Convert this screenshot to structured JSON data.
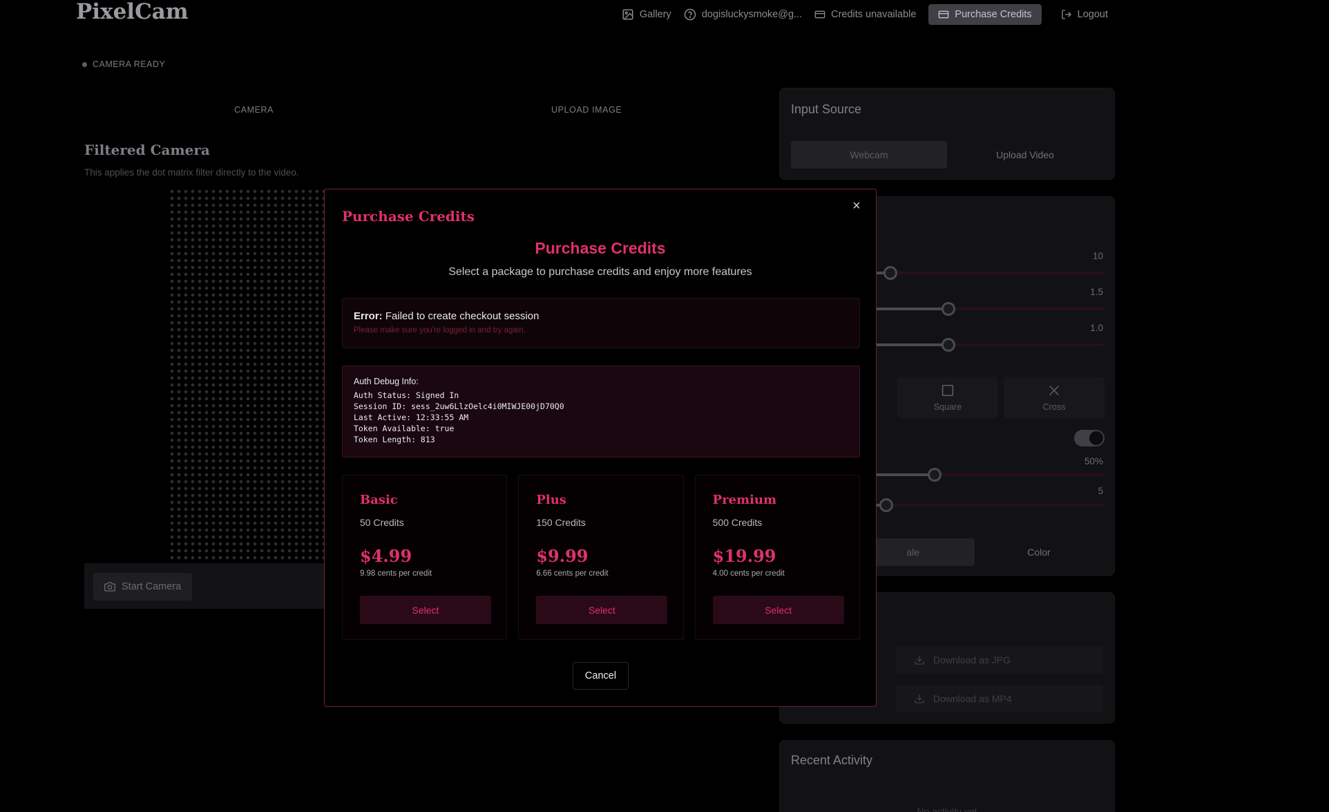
{
  "header": {
    "logo": "PixelCam",
    "nav": {
      "gallery": "Gallery",
      "email": "dogisluckysmoke@g...",
      "credits": "Credits unavailable",
      "purchase": "Purchase Credits",
      "logout": "Logout"
    }
  },
  "camera": {
    "status": "CAMERA READY",
    "tab_camera": "CAMERA",
    "tab_upload": "UPLOAD IMAGE",
    "title": "Filtered Camera",
    "subtitle": "This applies the dot matrix filter directly to the video.",
    "start_button": "Start Camera"
  },
  "input_source": {
    "title": "Input Source",
    "tab_webcam": "Webcam",
    "tab_upload_video": "Upload Video"
  },
  "settings": {
    "slider_values": [
      "10",
      "1.5",
      "1.0",
      "50%",
      "5"
    ],
    "shape_square": "Square",
    "shape_cross": "Cross",
    "mode_grayscale_partial": "ale",
    "mode_color": "Color"
  },
  "export": {
    "jpg": "Download as JPG",
    "mp4": "Download as MP4"
  },
  "activity": {
    "title": "Recent Activity",
    "empty": "No activity yet"
  },
  "modal": {
    "header": "Purchase Credits",
    "title": "Purchase Credits",
    "subtitle": "Select a package to purchase credits and enjoy more features",
    "error": {
      "label": "Error:",
      "message": " Failed to create checkout session",
      "hint": "Please make sure you're logged in and try again."
    },
    "debug": {
      "title": "Auth Debug Info:",
      "lines": [
        "Auth Status: Signed In",
        "Session ID: sess_2uw6LlzOelc4i0MIWJE00jD70Q0",
        "Last Active: 12:33:55 AM",
        "Token Available: true",
        "Token Length: 813"
      ]
    },
    "plans": [
      {
        "name": "Basic",
        "credits": "50 Credits",
        "price": "$4.99",
        "per_credit": "9.98 cents per credit",
        "button": "Select"
      },
      {
        "name": "Plus",
        "credits": "150 Credits",
        "price": "$9.99",
        "per_credit": "6.66 cents per credit",
        "button": "Select"
      },
      {
        "name": "Premium",
        "credits": "500 Credits",
        "price": "$19.99",
        "per_credit": "4.00 cents per credit",
        "button": "Select"
      }
    ],
    "cancel": "Cancel",
    "close_symbol": "×"
  },
  "colors": {
    "accent": "#e0306e",
    "modal_border": "#7a1a3f",
    "background": "#000000"
  }
}
